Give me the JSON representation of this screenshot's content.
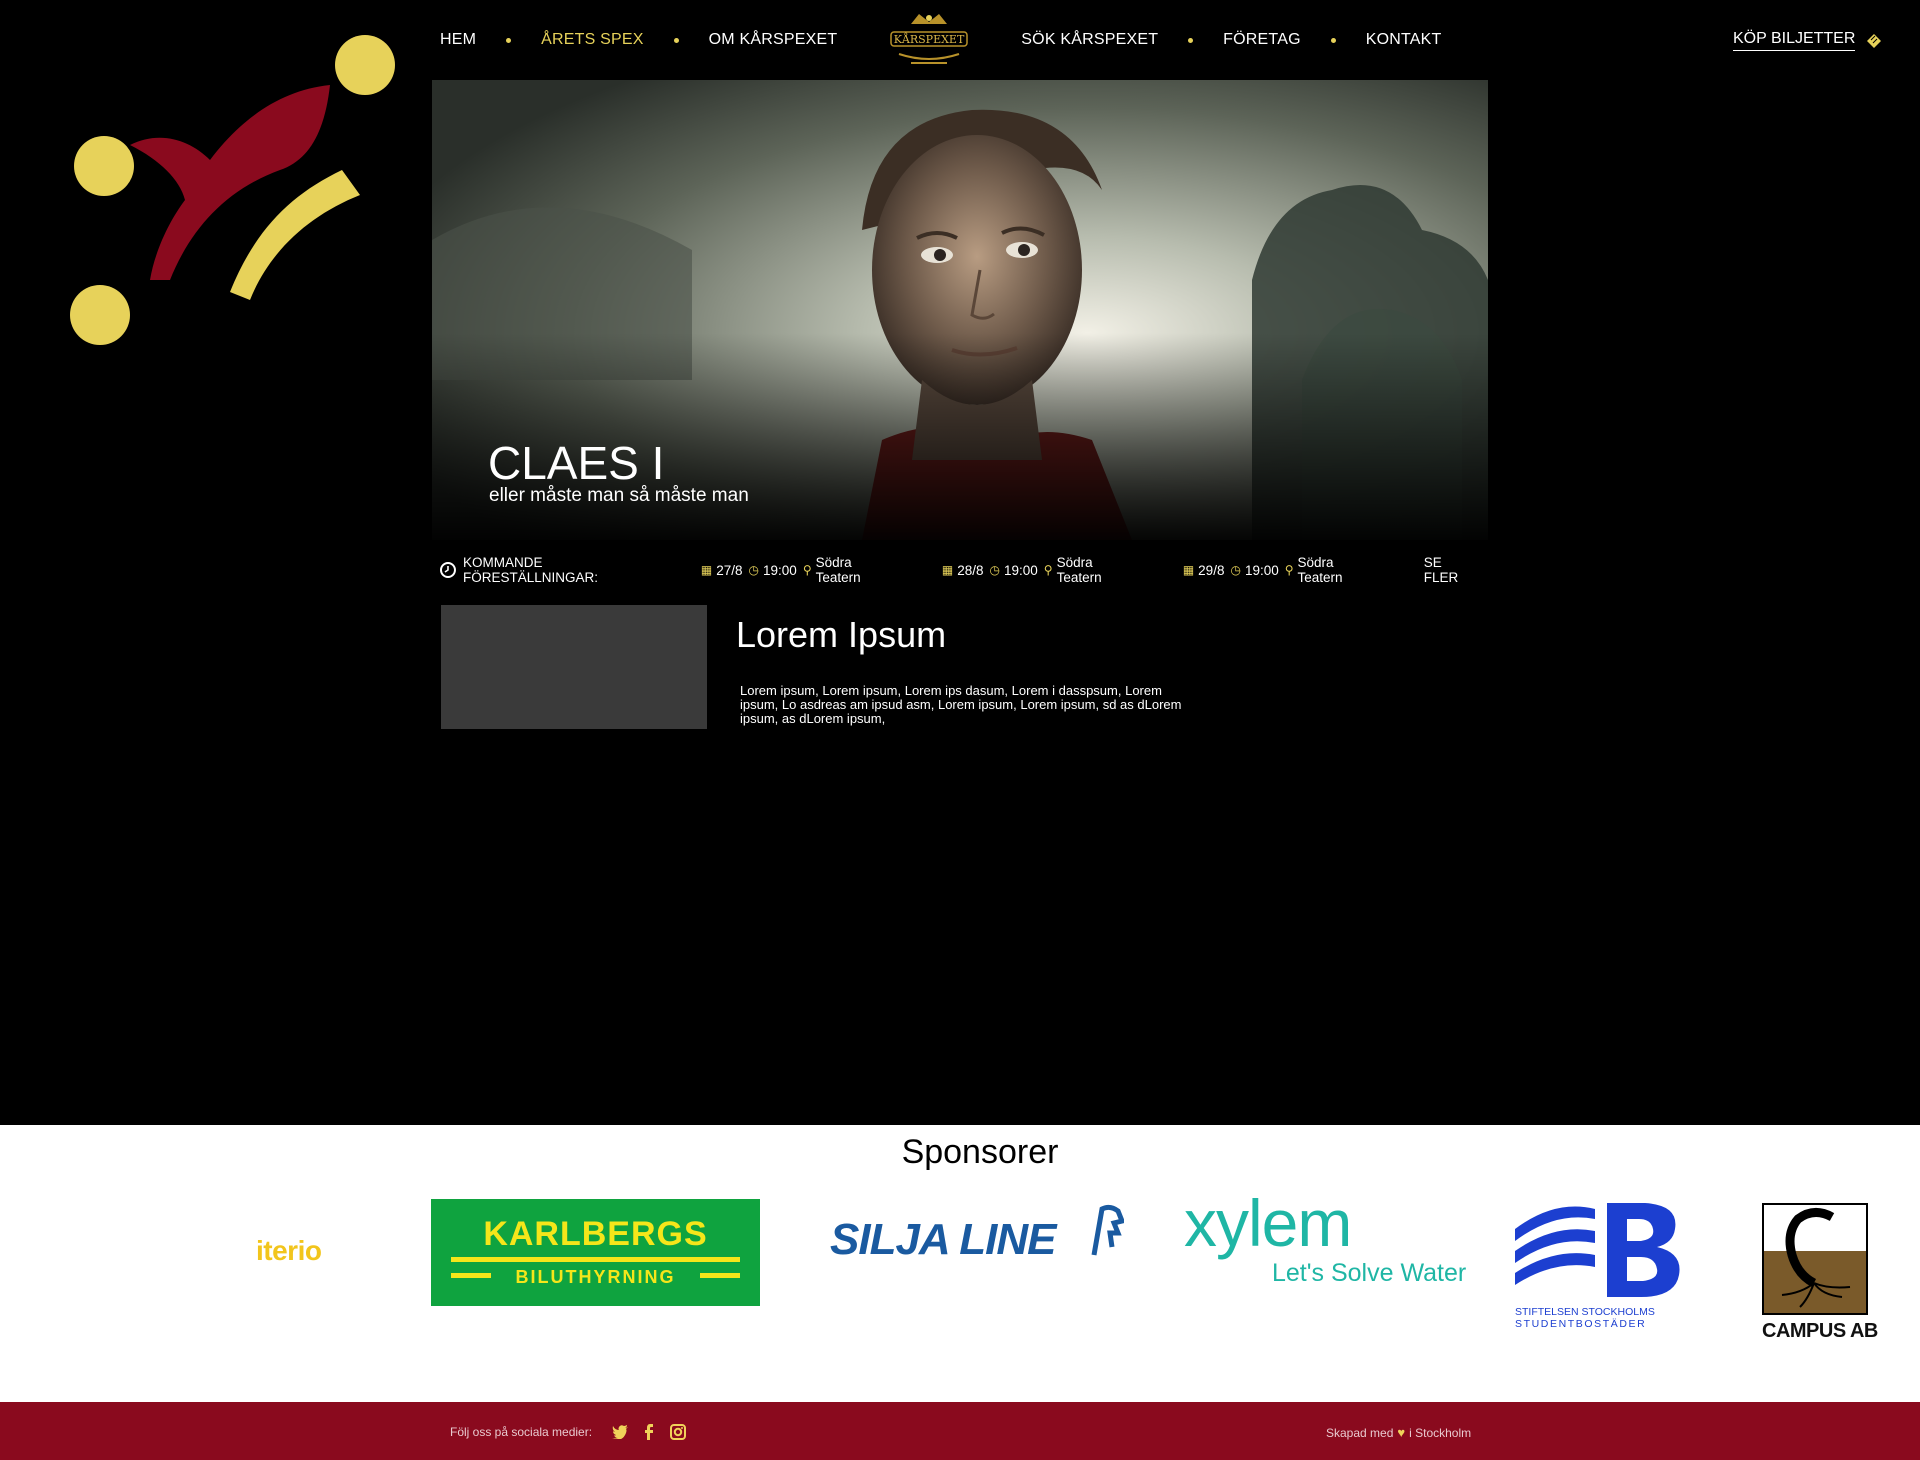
{
  "nav": {
    "items": [
      {
        "label": "HEM",
        "active": false
      },
      {
        "label": "ÅRETS SPEX",
        "active": true
      },
      {
        "label": "OM KÅRSPEXET",
        "active": false
      },
      {
        "label": "SÖK KÅRSPEXET",
        "active": false
      },
      {
        "label": "FÖRETAG",
        "active": false
      },
      {
        "label": "KONTAKT",
        "active": false
      }
    ],
    "logo_text": "KÅRSPEXET",
    "buy_label": "KÖP BILJETTER"
  },
  "hero": {
    "title": "CLAES I",
    "subtitle": "eller måste man så måste man"
  },
  "performances": {
    "heading": "KOMMANDE FÖRESTÄLLNINGAR:",
    "items": [
      {
        "date": "27/8",
        "time": "19:00",
        "venue": "Södra Teatern"
      },
      {
        "date": "28/8",
        "time": "19:00",
        "venue": "Södra Teatern"
      },
      {
        "date": "29/8",
        "time": "19:00",
        "venue": "Södra Teatern"
      }
    ],
    "see_more": "SE FLER"
  },
  "content": {
    "title": "Lorem Ipsum",
    "text": "Lorem ipsum, Lorem ipsum, Lorem ips dasum, Lorem i dasspsum, Lorem ipsum, Lo asdreas am ipsud asm, Lorem ipsum, Lorem ipsum, sd as dLorem ipsum,  as dLorem ipsum,"
  },
  "sponsors": {
    "title": "Sponsorer",
    "logos": [
      {
        "name": "iterio"
      },
      {
        "name": "KARLBERGS",
        "sub": "BILUTHYRNING"
      },
      {
        "name": "SILJA LINE"
      },
      {
        "name": "xylem",
        "sub": "Let's Solve Water"
      },
      {
        "name": "SSSB",
        "sub1": "STIFTELSEN STOCKHOLMS",
        "sub2": "STUDENTBOSTÄDER"
      },
      {
        "name": "CAMPUS AB"
      }
    ]
  },
  "footer": {
    "follow_label": "Följ oss på sociala medier:",
    "made_prefix": "Skapad med",
    "made_suffix": "i Stockholm"
  },
  "colors": {
    "accent": "#e7d25a",
    "brand_red": "#8a0a1e",
    "background": "#000000"
  }
}
